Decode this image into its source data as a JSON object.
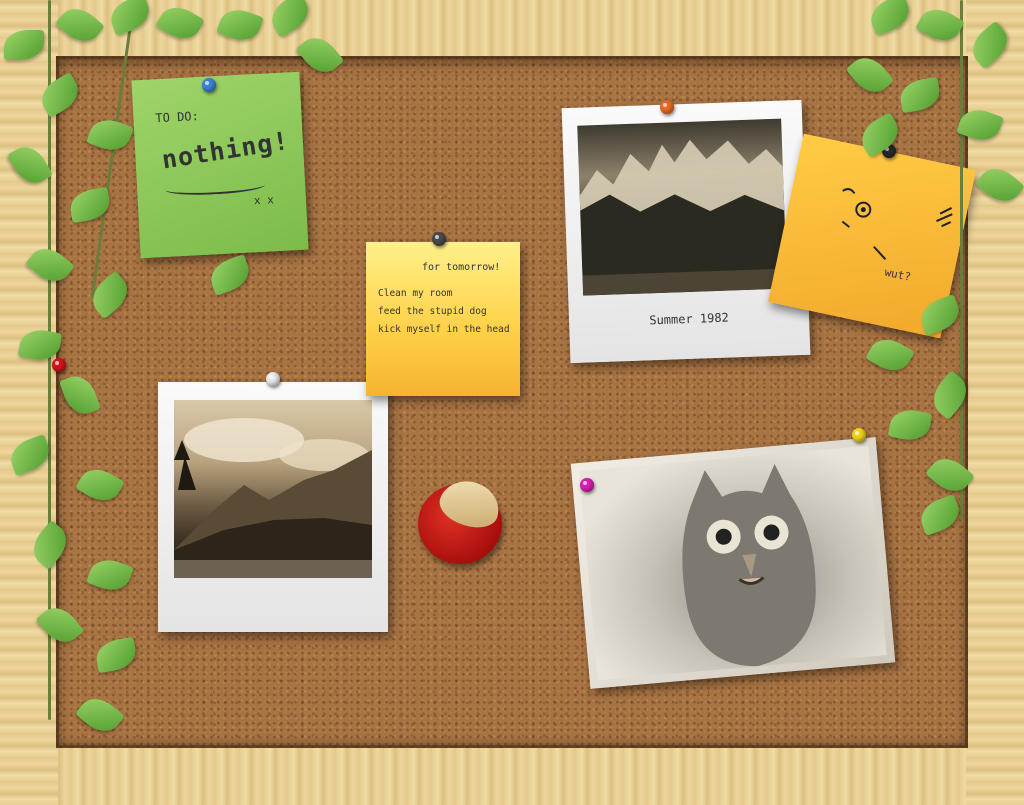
{
  "notes": {
    "todo": {
      "label": "TO DO:",
      "main": "nothing!",
      "face": "x x"
    },
    "tomorrow": {
      "heading": "for tomorrow!",
      "items": [
        "Clean my room",
        "feed the stupid dog",
        "kick myself in the head"
      ]
    },
    "wut": {
      "caption": "wut?"
    }
  },
  "photos": {
    "summer": {
      "caption": "Summer 1982"
    }
  },
  "colors": {
    "cork": "#a87343",
    "frame": "#e8cf92",
    "note_green": "#8fca5a",
    "note_yellow": "#ffd24a",
    "note_orange": "#ffc03a",
    "pins": [
      "#3a82d6",
      "#e86a22",
      "#4a4a4a",
      "#2a2a2a",
      "#d4141c",
      "#e8e8e8",
      "#d81fb4",
      "#f0d21a"
    ]
  }
}
